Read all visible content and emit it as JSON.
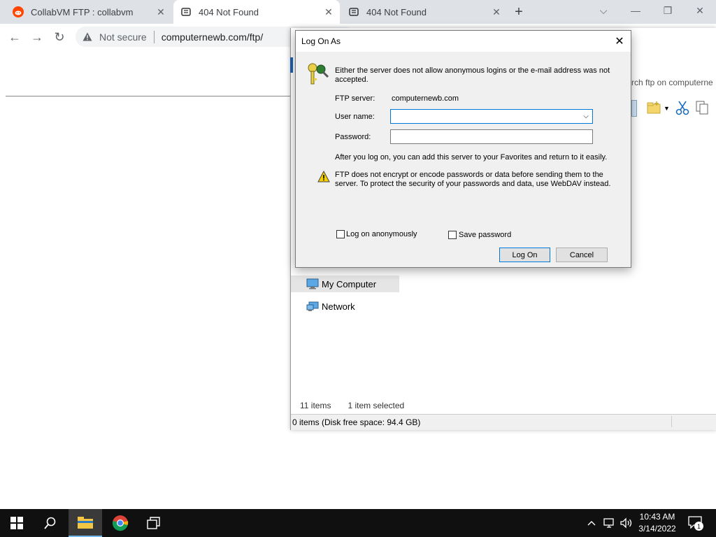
{
  "browser": {
    "tabs": [
      {
        "title": "CollabVM FTP : collabvm",
        "icon": "reddit-icon",
        "active": false
      },
      {
        "title": "404 Not Found",
        "icon": "ftp-icon",
        "active": true
      },
      {
        "title": "404 Not Found",
        "icon": "ftp-icon",
        "active": false
      }
    ],
    "new_tab": "+",
    "security_label": "Not secure",
    "url": "computernewb.com/ftp/"
  },
  "explorer": {
    "search_placeholder": "rch ftp on computerne",
    "nav_items": [
      {
        "label": "My Computer",
        "icon": "computer-icon"
      },
      {
        "label": "Network",
        "icon": "network-icon"
      }
    ],
    "status_items": "11 items",
    "status_selected": "1 item selected",
    "status_bottom": "0 items (Disk free space: 94.4 GB)"
  },
  "dialog": {
    "title": "Log On As",
    "message": "Either the server does not allow anonymous logins or the e-mail address was not accepted.",
    "server_label": "FTP server:",
    "server_value": "computernewb.com",
    "username_label": "User name:",
    "username_value": "",
    "password_label": "Password:",
    "password_value": "",
    "info": "After you log on, you can add this server to your Favorites and return to it easily.",
    "warning": "FTP does not encrypt or encode passwords or data before sending them to the server.  To protect the security of your passwords and data, use WebDAV instead.",
    "anon_label": "Log on anonymously",
    "save_label": "Save password",
    "logon_button": "Log On",
    "cancel_button": "Cancel"
  },
  "taskbar": {
    "time": "10:43 AM",
    "date": "3/14/2022",
    "notification_count": "1"
  }
}
